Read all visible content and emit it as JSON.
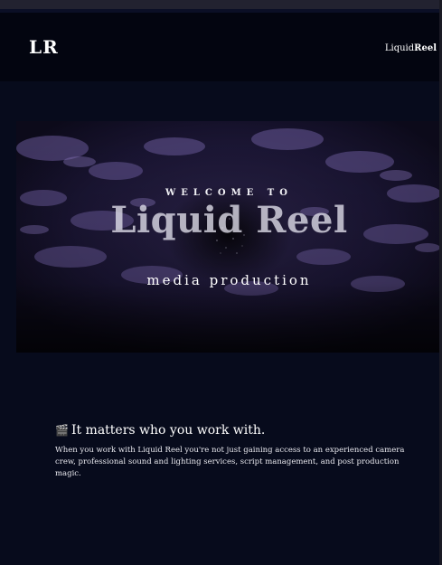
{
  "nav": {
    "logo": "LR",
    "brand_light": "Liquid",
    "brand_bold": "Reel"
  },
  "hero": {
    "welcome": "WELCOME TO",
    "title": "Liquid Reel",
    "subtitle": "media production"
  },
  "intro": {
    "icon": "clapperboard-icon",
    "emoji": "🎬",
    "heading": "It matters who you work with.",
    "paragraph": "When you work with Liquid Reel you're not just gaining access to an experienced camera crew, professional sound and lighting services, script management, and post production magic."
  },
  "colors": {
    "page_background": "#070b1c",
    "navbar_background": "#030510",
    "hero_tint": "#15112a",
    "text": "#ffffff"
  }
}
